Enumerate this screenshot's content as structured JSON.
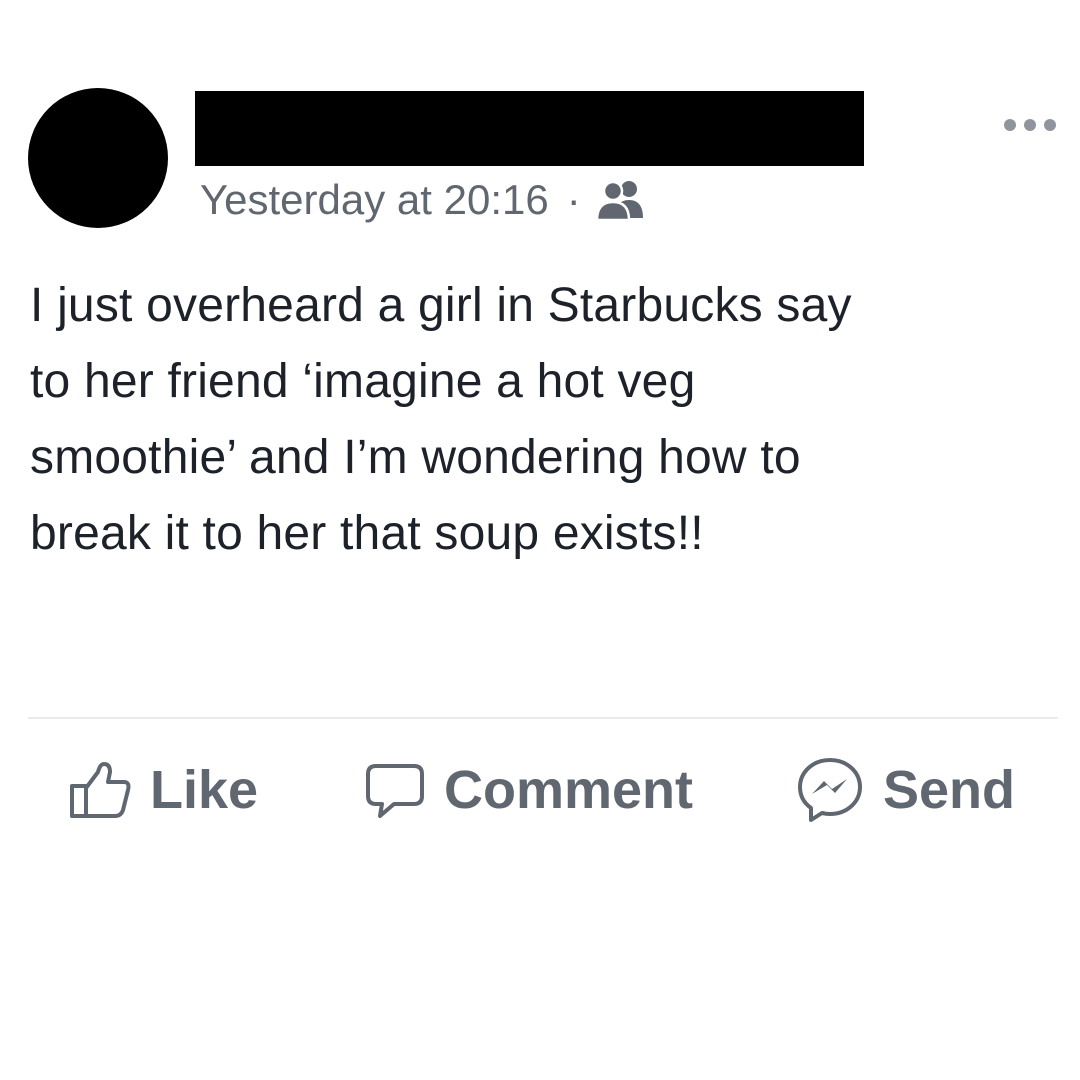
{
  "post": {
    "author_avatar": "avatar-redacted",
    "author_name_redacted": true,
    "timestamp": "Yesterday at 20:16",
    "separator": "·",
    "audience_icon": "friends-icon",
    "more_icon": "more-horizontal-icon",
    "text": "I just overheard a girl in Starbucks say\nto her friend ‘imagine a hot veg\nsmoothie’ and I’m wondering how to\nbreak it to her that soup exists!!"
  },
  "actions": {
    "like": {
      "label": "Like",
      "icon": "thumbs-up-icon"
    },
    "comment": {
      "label": "Comment",
      "icon": "comment-bubble-icon"
    },
    "send": {
      "label": "Send",
      "icon": "messenger-icon"
    }
  },
  "colors": {
    "text_primary": "#1d2129",
    "text_secondary": "#616770",
    "action_gray": "#606770",
    "divider": "#e9ebee",
    "redaction": "#000000"
  }
}
